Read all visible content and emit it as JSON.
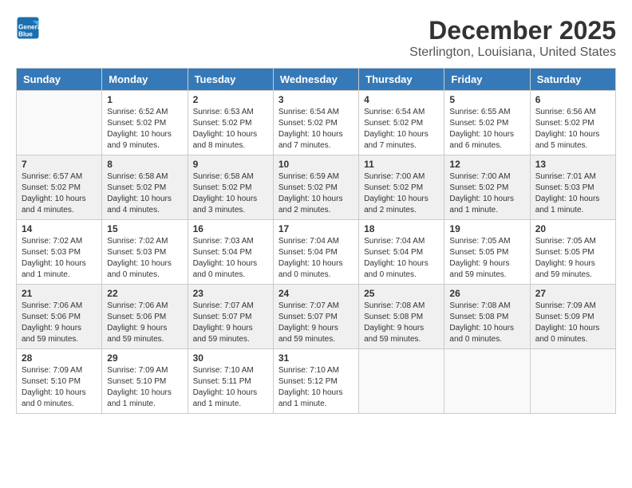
{
  "logo": {
    "line1": "General",
    "line2": "Blue"
  },
  "title": "December 2025",
  "location": "Sterlington, Louisiana, United States",
  "headers": [
    "Sunday",
    "Monday",
    "Tuesday",
    "Wednesday",
    "Thursday",
    "Friday",
    "Saturday"
  ],
  "weeks": [
    [
      {
        "day": "",
        "info": ""
      },
      {
        "day": "1",
        "info": "Sunrise: 6:52 AM\nSunset: 5:02 PM\nDaylight: 10 hours\nand 9 minutes."
      },
      {
        "day": "2",
        "info": "Sunrise: 6:53 AM\nSunset: 5:02 PM\nDaylight: 10 hours\nand 8 minutes."
      },
      {
        "day": "3",
        "info": "Sunrise: 6:54 AM\nSunset: 5:02 PM\nDaylight: 10 hours\nand 7 minutes."
      },
      {
        "day": "4",
        "info": "Sunrise: 6:54 AM\nSunset: 5:02 PM\nDaylight: 10 hours\nand 7 minutes."
      },
      {
        "day": "5",
        "info": "Sunrise: 6:55 AM\nSunset: 5:02 PM\nDaylight: 10 hours\nand 6 minutes."
      },
      {
        "day": "6",
        "info": "Sunrise: 6:56 AM\nSunset: 5:02 PM\nDaylight: 10 hours\nand 5 minutes."
      }
    ],
    [
      {
        "day": "7",
        "info": "Sunrise: 6:57 AM\nSunset: 5:02 PM\nDaylight: 10 hours\nand 4 minutes."
      },
      {
        "day": "8",
        "info": "Sunrise: 6:58 AM\nSunset: 5:02 PM\nDaylight: 10 hours\nand 4 minutes."
      },
      {
        "day": "9",
        "info": "Sunrise: 6:58 AM\nSunset: 5:02 PM\nDaylight: 10 hours\nand 3 minutes."
      },
      {
        "day": "10",
        "info": "Sunrise: 6:59 AM\nSunset: 5:02 PM\nDaylight: 10 hours\nand 2 minutes."
      },
      {
        "day": "11",
        "info": "Sunrise: 7:00 AM\nSunset: 5:02 PM\nDaylight: 10 hours\nand 2 minutes."
      },
      {
        "day": "12",
        "info": "Sunrise: 7:00 AM\nSunset: 5:02 PM\nDaylight: 10 hours\nand 1 minute."
      },
      {
        "day": "13",
        "info": "Sunrise: 7:01 AM\nSunset: 5:03 PM\nDaylight: 10 hours\nand 1 minute."
      }
    ],
    [
      {
        "day": "14",
        "info": "Sunrise: 7:02 AM\nSunset: 5:03 PM\nDaylight: 10 hours\nand 1 minute."
      },
      {
        "day": "15",
        "info": "Sunrise: 7:02 AM\nSunset: 5:03 PM\nDaylight: 10 hours\nand 0 minutes."
      },
      {
        "day": "16",
        "info": "Sunrise: 7:03 AM\nSunset: 5:04 PM\nDaylight: 10 hours\nand 0 minutes."
      },
      {
        "day": "17",
        "info": "Sunrise: 7:04 AM\nSunset: 5:04 PM\nDaylight: 10 hours\nand 0 minutes."
      },
      {
        "day": "18",
        "info": "Sunrise: 7:04 AM\nSunset: 5:04 PM\nDaylight: 10 hours\nand 0 minutes."
      },
      {
        "day": "19",
        "info": "Sunrise: 7:05 AM\nSunset: 5:05 PM\nDaylight: 9 hours\nand 59 minutes."
      },
      {
        "day": "20",
        "info": "Sunrise: 7:05 AM\nSunset: 5:05 PM\nDaylight: 9 hours\nand 59 minutes."
      }
    ],
    [
      {
        "day": "21",
        "info": "Sunrise: 7:06 AM\nSunset: 5:06 PM\nDaylight: 9 hours\nand 59 minutes."
      },
      {
        "day": "22",
        "info": "Sunrise: 7:06 AM\nSunset: 5:06 PM\nDaylight: 9 hours\nand 59 minutes."
      },
      {
        "day": "23",
        "info": "Sunrise: 7:07 AM\nSunset: 5:07 PM\nDaylight: 9 hours\nand 59 minutes."
      },
      {
        "day": "24",
        "info": "Sunrise: 7:07 AM\nSunset: 5:07 PM\nDaylight: 9 hours\nand 59 minutes."
      },
      {
        "day": "25",
        "info": "Sunrise: 7:08 AM\nSunset: 5:08 PM\nDaylight: 9 hours\nand 59 minutes."
      },
      {
        "day": "26",
        "info": "Sunrise: 7:08 AM\nSunset: 5:08 PM\nDaylight: 10 hours\nand 0 minutes."
      },
      {
        "day": "27",
        "info": "Sunrise: 7:09 AM\nSunset: 5:09 PM\nDaylight: 10 hours\nand 0 minutes."
      }
    ],
    [
      {
        "day": "28",
        "info": "Sunrise: 7:09 AM\nSunset: 5:10 PM\nDaylight: 10 hours\nand 0 minutes."
      },
      {
        "day": "29",
        "info": "Sunrise: 7:09 AM\nSunset: 5:10 PM\nDaylight: 10 hours\nand 1 minute."
      },
      {
        "day": "30",
        "info": "Sunrise: 7:10 AM\nSunset: 5:11 PM\nDaylight: 10 hours\nand 1 minute."
      },
      {
        "day": "31",
        "info": "Sunrise: 7:10 AM\nSunset: 5:12 PM\nDaylight: 10 hours\nand 1 minute."
      },
      {
        "day": "",
        "info": ""
      },
      {
        "day": "",
        "info": ""
      },
      {
        "day": "",
        "info": ""
      }
    ]
  ]
}
